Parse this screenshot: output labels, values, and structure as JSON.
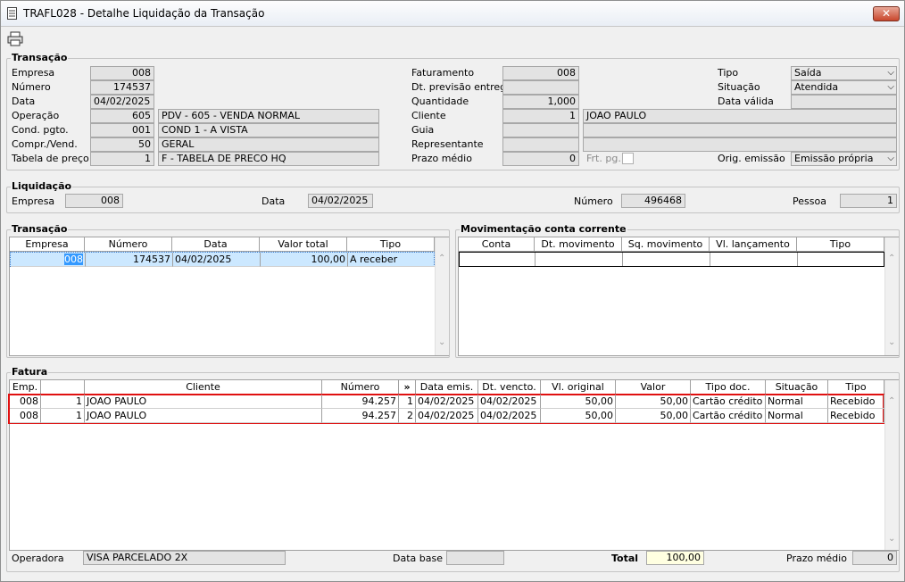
{
  "window": {
    "title": "TRAFL028 - Detalhe Liquidação da Transação",
    "close": "✕"
  },
  "toolbar": {
    "print": "🖶"
  },
  "transacao_top": {
    "title": "Transação",
    "empresa_label": "Empresa",
    "empresa": "008",
    "numero_label": "Número",
    "numero": "174537",
    "data_label": "Data",
    "data": "04/02/2025",
    "operacao_label": "Operação",
    "operacao_cod": "605",
    "operacao_desc": "PDV - 605 - VENDA NORMAL",
    "cond_label": "Cond. pgto.",
    "cond_cod": "001",
    "cond_desc": "COND 1 - A VISTA",
    "compr_label": "Compr./Vend.",
    "compr_cod": "50",
    "compr_desc": "GERAL",
    "tabela_label": "Tabela de preço",
    "tabela_cod": "1",
    "tabela_desc": "F - TABELA DE PRECO HQ",
    "faturamento_label": "Faturamento",
    "faturamento": "008",
    "dtprev_label": "Dt. previsão entrega",
    "dtprev": "",
    "quantidade_label": "Quantidade",
    "quantidade": "1,000",
    "cliente_label": "Cliente",
    "cliente_cod": "1",
    "cliente_nome": "JOAO PAULO",
    "guia_label": "Guia",
    "guia": "",
    "representante_label": "Representante",
    "representante": "",
    "prazo_label": "Prazo médio",
    "prazo": "0",
    "frtpg_label": "Frt. pg.",
    "tipo_label": "Tipo",
    "tipo": "Saída",
    "situacao_label": "Situação",
    "situacao": "Atendida",
    "datavalida_label": "Data válida",
    "datavalida": "",
    "origem_label": "Orig. emissão",
    "origem": "Emissão própria"
  },
  "liquidacao": {
    "title": "Liquidação",
    "empresa_label": "Empresa",
    "empresa": "008",
    "data_label": "Data",
    "data": "04/02/2025",
    "numero_label": "Número",
    "numero": "496468",
    "pessoa_label": "Pessoa",
    "pessoa": "1"
  },
  "transacao_grid": {
    "title": "Transação",
    "headers": [
      "Empresa",
      "Número",
      "Data",
      "Valor total",
      "Tipo"
    ],
    "rows": [
      [
        "008",
        "174537",
        "04/02/2025",
        "100,00",
        "A receber"
      ]
    ]
  },
  "movimentacao": {
    "title": "Movimentação conta corrente",
    "headers": [
      "Conta",
      "Dt. movimento",
      "Sq. movimento",
      "Vl. lançamento",
      "Tipo"
    ]
  },
  "fatura": {
    "title": "Fatura",
    "headers": [
      "Emp.",
      "",
      "Cliente",
      "Número",
      "»",
      "Data emis.",
      "Dt. vencto.",
      "Vl. original",
      "Valor",
      "Tipo doc.",
      "Situação",
      "Tipo"
    ],
    "rows": [
      [
        "008",
        "1",
        "JOAO PAULO",
        "94.257",
        "1",
        "04/02/2025",
        "04/02/2025",
        "50,00",
        "50,00",
        "Cartão crédito",
        "Normal",
        "Recebido"
      ],
      [
        "008",
        "1",
        "JOAO PAULO",
        "94.257",
        "2",
        "04/02/2025",
        "04/02/2025",
        "50,00",
        "50,00",
        "Cartão crédito",
        "Normal",
        "Recebido"
      ]
    ],
    "operadora_label": "Operadora",
    "operadora": "VISA PARCELADO 2X",
    "database_label": "Data base",
    "database": "",
    "total_label": "Total",
    "total": "100,00",
    "prazo_label": "Prazo médio",
    "prazo": "0"
  },
  "colors": {
    "highlight_border": "#e01010",
    "selected_row": "#cce8ff",
    "total_bg": "#ffffe1"
  }
}
